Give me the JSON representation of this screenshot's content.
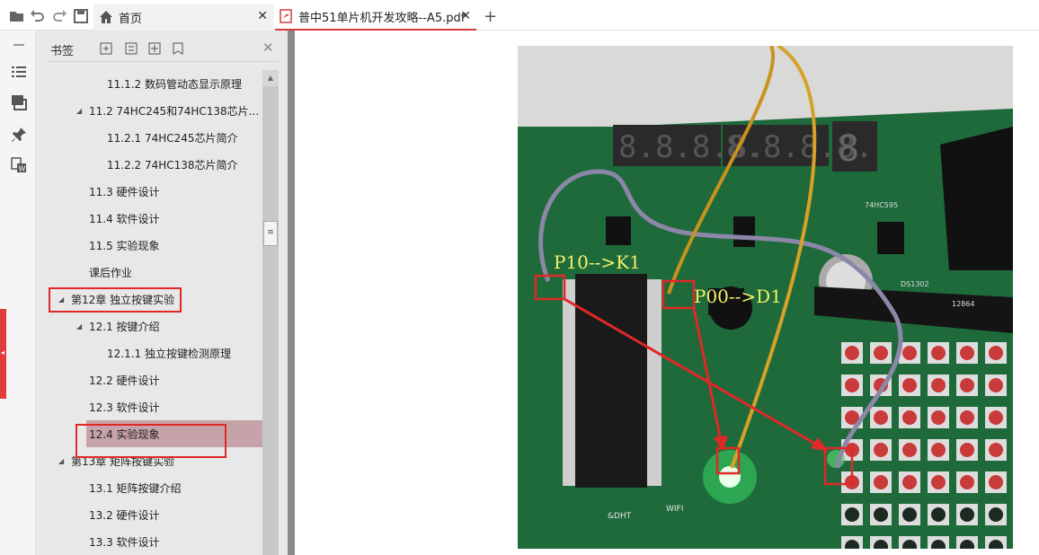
{
  "toolbar": {
    "icons": [
      "folder-open-icon",
      "undo-icon",
      "redo-icon",
      "save-icon"
    ]
  },
  "tabs": [
    {
      "label": "首页",
      "icon": "home-icon",
      "active": false
    },
    {
      "label": "普中51单片机开发攻略--A5.pdf",
      "icon": "pdf-icon",
      "active": true
    }
  ],
  "bookmarks": {
    "title": "书签",
    "tools": [
      "expand-all-icon",
      "collapse-all-icon",
      "add-bookmark-icon",
      "bookmark-options-icon"
    ],
    "items": [
      {
        "label": "11.1.2 数码管动态显示原理",
        "level": 3
      },
      {
        "label": "11.2 74HC245和74HC138芯片...",
        "level": 2,
        "expanded": true
      },
      {
        "label": "11.2.1 74HC245芯片简介",
        "level": 3
      },
      {
        "label": "11.2.2 74HC138芯片简介",
        "level": 3
      },
      {
        "label": "11.3 硬件设计",
        "level": 2
      },
      {
        "label": "11.4 软件设计",
        "level": 2
      },
      {
        "label": "11.5 实验现象",
        "level": 2
      },
      {
        "label": "课后作业",
        "level": 2
      },
      {
        "label": "第12章 独立按键实验",
        "level": 1,
        "expanded": true,
        "highlighted": true
      },
      {
        "label": "12.1 按键介绍",
        "level": 2,
        "expanded": true
      },
      {
        "label": "12.1.1 独立按键检测原理",
        "level": 3
      },
      {
        "label": "12.2 硬件设计",
        "level": 2
      },
      {
        "label": "12.3 软件设计",
        "level": 2
      },
      {
        "label": "12.4 实验现象",
        "level": 2,
        "selected": true,
        "highlighted": true
      },
      {
        "label": "第13章 矩阵按键实验",
        "level": 1,
        "expanded": true
      },
      {
        "label": "13.1 矩阵按键介绍",
        "level": 2
      },
      {
        "label": "13.2 硬件设计",
        "level": 2
      },
      {
        "label": "13.3 软件设计",
        "level": 2
      }
    ]
  },
  "rail": {
    "icons": [
      "minimize-icon",
      "list-icon",
      "pages-icon",
      "pin-icon",
      "convert-word-icon"
    ]
  },
  "document": {
    "photo": {
      "annotations": [
        "P10-->K1",
        "P00-->D1"
      ],
      "digit_display_1": "8.8.8.8.",
      "digit_display_2": "8.8.8.8.",
      "digit_display_3": "8",
      "chip_label_1": "74HC595",
      "chip_label_2": "DS1302",
      "chip_label_3": "12864",
      "label_wifi": "WIFI",
      "label_dht": "&DHT"
    }
  },
  "colors": {
    "accent": "#d63a3a",
    "annotation_box": "#e02828",
    "annotation_text": "#f5f06a",
    "selected_row": "#c6a3a8",
    "pcb_green": "#1f6d3c"
  }
}
